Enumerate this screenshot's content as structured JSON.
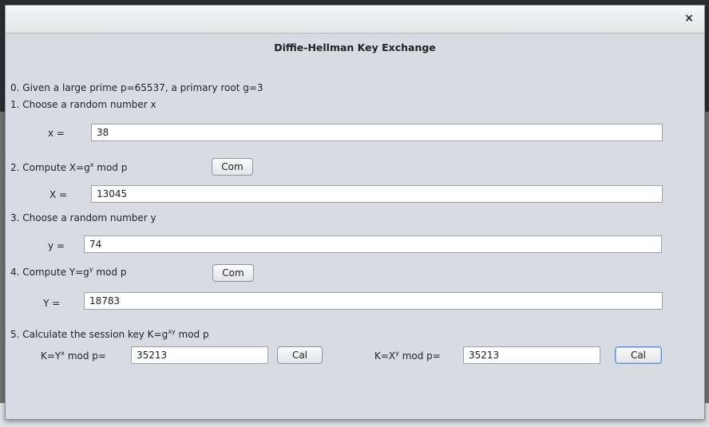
{
  "window": {
    "title": "Diffie-Hellman Key Exchange",
    "close_glyph": "×"
  },
  "steps": {
    "step0": "0. Given a large prime p=65537, a primary root g=3",
    "step1": "1. Choose a random number x",
    "step2_prefix": "2. Compute X=g",
    "step2_sup": "x",
    "step2_suffix": " mod p",
    "step3": "3. Choose a random number y",
    "step4_prefix": "4. Compute Y=g",
    "step4_sup": "y",
    "step4_suffix": " mod p",
    "step5_prefix": "5. Calculate the session key K=g",
    "step5_sup": "xy",
    "step5_suffix": " mod p"
  },
  "fields": {
    "x_label": "x =",
    "x_value": "38",
    "X_label": "X =",
    "X_value": "13045",
    "y_label": "y =",
    "y_value": "74",
    "Y_label": "Y =",
    "Y_value": "18783",
    "k1_label_prefix": "K=Y",
    "k1_label_sup": "x",
    "k1_label_suffix": " mod p=",
    "k1_value": "35213",
    "k2_label_prefix": "K=X",
    "k2_label_sup": "y",
    "k2_label_suffix": " mod p=",
    "k2_value": "35213"
  },
  "buttons": {
    "compute_X": "Com",
    "compute_Y": "Com",
    "calc_k1": "Cal",
    "calc_k2": "Cal"
  }
}
